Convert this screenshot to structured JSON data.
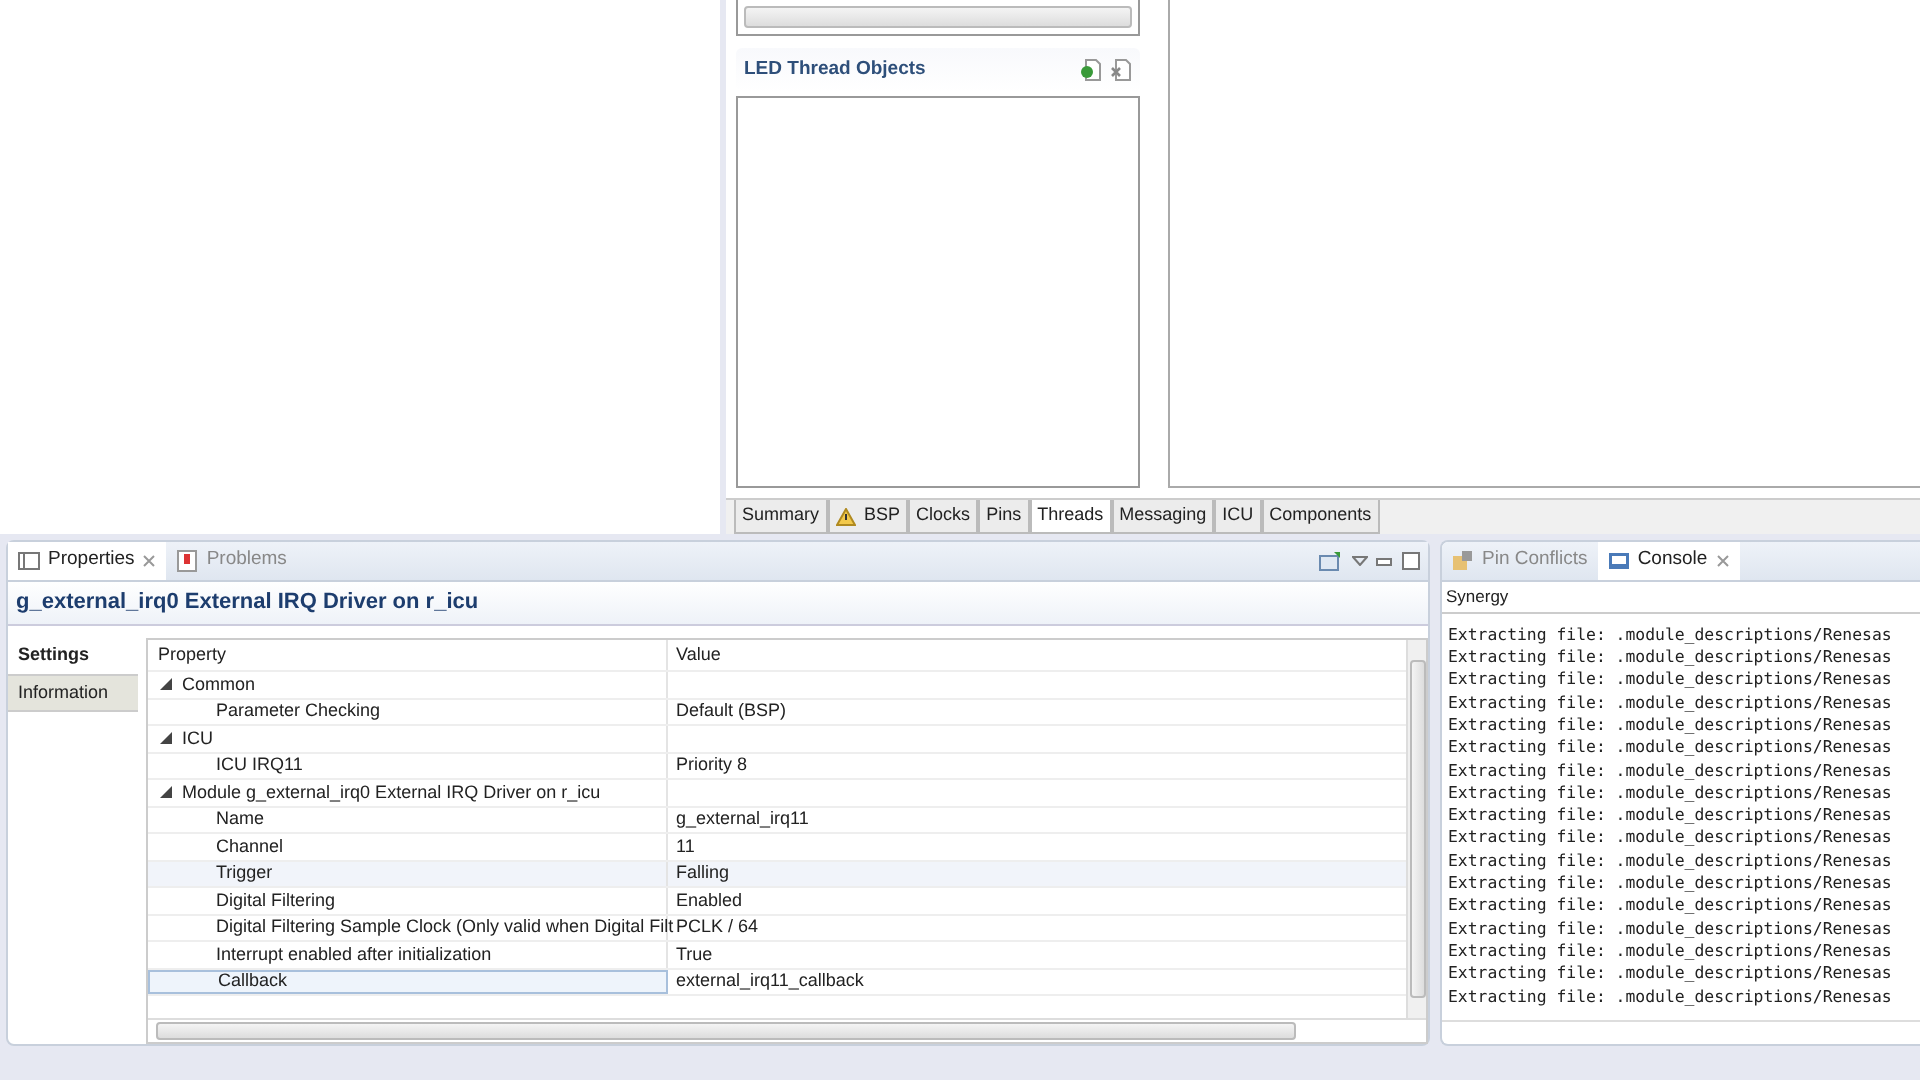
{
  "editor": {
    "thread_objects": {
      "title": "LED Thread Objects"
    },
    "tabs": [
      {
        "label": "Summary",
        "selected": false,
        "warning": false
      },
      {
        "label": "BSP",
        "selected": false,
        "warning": true
      },
      {
        "label": "Clocks",
        "selected": false,
        "warning": false
      },
      {
        "label": "Pins",
        "selected": false,
        "warning": false
      },
      {
        "label": "Threads",
        "selected": true,
        "warning": false
      },
      {
        "label": "Messaging",
        "selected": false,
        "warning": false
      },
      {
        "label": "ICU",
        "selected": false,
        "warning": false
      },
      {
        "label": "Components",
        "selected": false,
        "warning": false
      }
    ]
  },
  "properties_view": {
    "tabs": [
      {
        "label": "Properties",
        "selected": true,
        "closable": true
      },
      {
        "label": "Problems",
        "selected": false,
        "closable": false
      }
    ],
    "title": "g_external_irq0 External IRQ Driver on r_icu",
    "side_tabs": [
      {
        "label": "Settings",
        "selected": true
      },
      {
        "label": "Information",
        "selected": false
      }
    ],
    "table": {
      "columns": [
        "Property",
        "Value"
      ],
      "rows": [
        {
          "property": "Common",
          "expanded": true,
          "children": [
            {
              "property": "Parameter Checking",
              "value": "Default (BSP)",
              "selected": false
            }
          ]
        },
        {
          "property": "ICU",
          "expanded": true,
          "children": [
            {
              "property": "ICU IRQ11",
              "value": "Priority 8",
              "selected": false
            }
          ]
        },
        {
          "property": "Module g_external_irq0 External IRQ Driver on r_icu",
          "expanded": true,
          "children": [
            {
              "property": "Name",
              "value": "g_external_irq11",
              "selected": false
            },
            {
              "property": "Channel",
              "value": "11",
              "selected": false
            },
            {
              "property": "Trigger",
              "value": "Falling",
              "selected": false,
              "hovered": true
            },
            {
              "property": "Digital Filtering",
              "value": "Enabled",
              "selected": false
            },
            {
              "property": "Digital Filtering Sample Clock (Only valid when Digital Filt",
              "value": "PCLK / 64",
              "selected": false
            },
            {
              "property": "Interrupt enabled after initialization",
              "value": "True",
              "selected": false
            },
            {
              "property": "Callback",
              "value": "external_irq11_callback",
              "selected": true
            }
          ]
        }
      ]
    }
  },
  "console_view": {
    "tabs": [
      {
        "label": "Pin Conflicts",
        "selected": false,
        "closable": false
      },
      {
        "label": "Console",
        "selected": true,
        "closable": true
      }
    ],
    "source": "Synergy",
    "lines": [
      "Extracting file: .module_descriptions/Renesas",
      "Extracting file: .module_descriptions/Renesas",
      "Extracting file: .module_descriptions/Renesas",
      "Extracting file: .module_descriptions/Renesas",
      "Extracting file: .module_descriptions/Renesas",
      "Extracting file: .module_descriptions/Renesas",
      "Extracting file: .module_descriptions/Renesas",
      "Extracting file: .module_descriptions/Renesas",
      "Extracting file: .module_descriptions/Renesas",
      "Extracting file: .module_descriptions/Renesas",
      "Extracting file: .module_descriptions/Renesas",
      "Extracting file: .module_descriptions/Renesas",
      "Extracting file: .module_descriptions/Renesas",
      "Extracting file: .module_descriptions/Renesas",
      "Extracting file: .module_descriptions/Renesas",
      "Extracting file: .module_descriptions/Renesas",
      "Extracting file: .module_descriptions/Renesas"
    ]
  }
}
